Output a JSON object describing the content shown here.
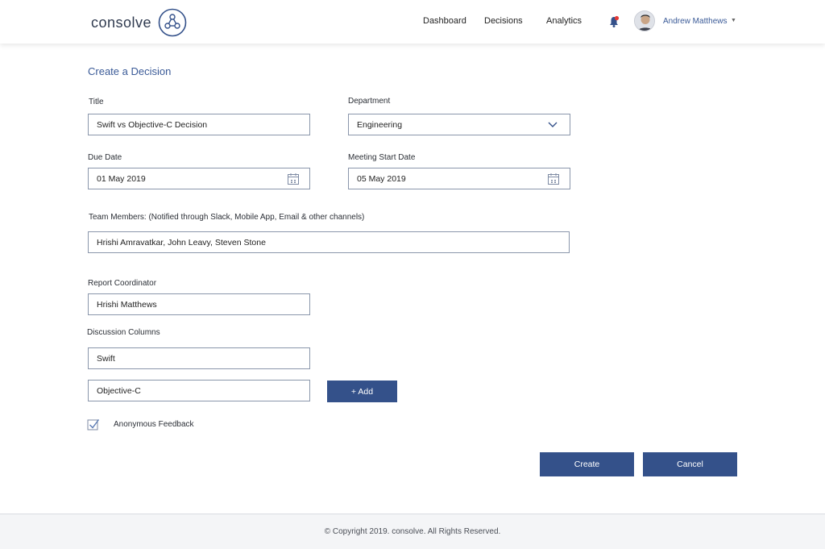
{
  "brand": {
    "name": "consolve"
  },
  "nav": {
    "items": [
      {
        "label": "Dashboard"
      },
      {
        "label": "Decisions"
      },
      {
        "label": "Analytics"
      }
    ]
  },
  "user": {
    "name": "Andrew Matthews"
  },
  "colors": {
    "primary": "#34518a",
    "accent_text": "#3a5a97",
    "bell_dot": "#e53935"
  },
  "form": {
    "heading": "Create a Decision",
    "title": {
      "label": "Title",
      "value": "Swift vs Objective-C Decision"
    },
    "department": {
      "label": "Department",
      "value": "Engineering"
    },
    "due_date": {
      "label": "Due Date",
      "value": "01 May 2019"
    },
    "meeting_start": {
      "label": "Meeting Start Date",
      "value": "05 May 2019"
    },
    "team_members": {
      "label": "Team Members: (Notified through Slack, Mobile App, Email & other channels)",
      "value": "Hrishi Amravatkar, John Leavy, Steven Stone"
    },
    "report_coordinator": {
      "label": "Report Coordinator",
      "value": "Hrishi Matthews"
    },
    "discussion_columns": {
      "label": "Discussion Columns",
      "values": [
        "Swift",
        "Objective-C"
      ],
      "add_label": "+ Add"
    },
    "anonymous_feedback": {
      "label": "Anonymous Feedback",
      "checked": true
    },
    "create_label": "Create",
    "cancel_label": "Cancel"
  },
  "footer": {
    "copyright": "© Copyright 2019. consolve. All Rights Reserved."
  }
}
